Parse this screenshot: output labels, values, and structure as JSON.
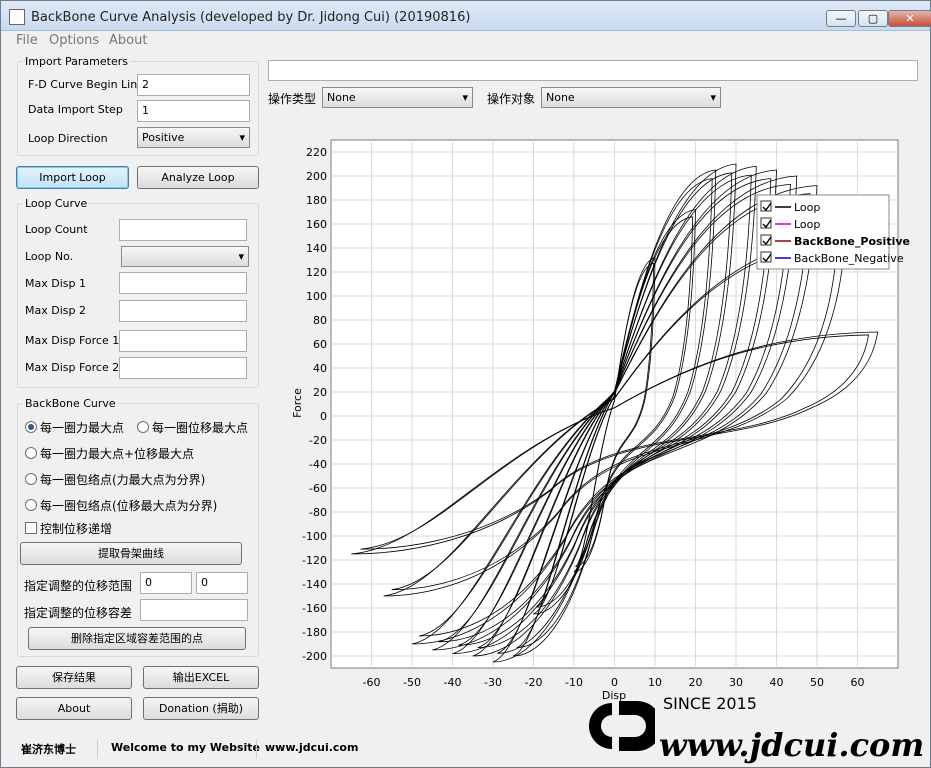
{
  "window": {
    "title": "BackBone Curve Analysis (developed by Dr. Jidong Cui) (20190816)"
  },
  "menubar": {
    "items": [
      "File",
      "Options",
      "About"
    ]
  },
  "import_parameters": {
    "title": "Import Parameters",
    "begin_line_label": "F-D Curve Begin Line",
    "begin_line_value": "2",
    "step_label": "Data Import Step",
    "step_value": "1",
    "direction_label": "Loop Direction",
    "direction_value": "Positive"
  },
  "buttons": {
    "import_loop": "Import Loop",
    "analyze_loop": "Analyze Loop",
    "extract": "提取骨架曲线",
    "delete_points": "删除指定区域容差范围的点",
    "save": "保存结果",
    "export_excel": "输出EXCEL",
    "about": "About",
    "donation": "Donation (捐助)"
  },
  "loop_curve": {
    "title": "Loop Curve",
    "count_label": "Loop Count",
    "no_label": "Loop No.",
    "max_disp1_label": "Max Disp 1",
    "max_disp2_label": "Max Disp 2",
    "max_force1_label": "Max Disp Force 1",
    "max_force2_label": "Max Disp Force 2",
    "values": [
      "",
      "",
      "",
      "",
      ""
    ]
  },
  "backbone": {
    "title": "BackBone Curve",
    "opt_force_max": "每一圈力最大点",
    "opt_disp_max": "每一圈位移最大点",
    "opt_force_disp_max": "每一圈力最大点+位移最大点",
    "opt_envelope_force": "每一圈包络点(力最大点为分界)",
    "opt_envelope_disp": "每一圈包络点(位移最大点为分界)",
    "monotonic_label": "控制位移递增",
    "range_label": "指定调整的位移范围",
    "range_from": "0",
    "range_to": "0",
    "tolerance_label": "指定调整的位移容差",
    "tolerance_value": ""
  },
  "operation": {
    "type_label": "操作类型",
    "type_value": "None",
    "object_label": "操作对象",
    "object_value": "None",
    "top_field": ""
  },
  "chart_data": {
    "type": "line",
    "xlabel": "Disp",
    "ylabel": "Force",
    "xlim": [
      -70,
      70
    ],
    "ylim": [
      -210,
      230
    ],
    "x_ticks": [
      -60,
      -50,
      -40,
      -30,
      -20,
      -10,
      0,
      10,
      20,
      30,
      40,
      50,
      60
    ],
    "y_ticks": [
      -200,
      -180,
      -160,
      -140,
      -120,
      -100,
      -80,
      -60,
      -40,
      -20,
      0,
      20,
      40,
      60,
      80,
      100,
      120,
      140,
      160,
      180,
      200,
      220
    ],
    "grid": true,
    "legend_position": "top-right",
    "legend": [
      "Loop",
      "Loop",
      "BackBone_Positive",
      "BackBone_Negative"
    ],
    "loop_amplitudes": [
      {
        "disp": 10,
        "force_pos": 132,
        "force_neg": -130
      },
      {
        "disp": 20,
        "force_pos": 172,
        "force_neg": -165
      },
      {
        "disp": 25,
        "force_pos": 205,
        "force_neg": -200
      },
      {
        "disp": 30,
        "force_pos": 210,
        "force_neg": -205
      },
      {
        "disp": 35,
        "force_pos": 208,
        "force_neg": -200
      },
      {
        "disp": 40,
        "force_pos": 205,
        "force_neg": -198
      },
      {
        "disp": 45,
        "force_pos": 200,
        "force_neg": -195
      },
      {
        "disp": 50,
        "force_pos": 192,
        "force_neg": -190
      },
      {
        "disp": 57,
        "force_pos": 150,
        "force_neg": -150
      },
      {
        "disp": 65,
        "force_pos": 70,
        "force_neg": -115
      }
    ]
  },
  "statusbar": {
    "author": "崔济东博士",
    "welcome": "Welcome to my Website",
    "url": "www.jdcui.com"
  },
  "watermark": {
    "since": "SINCE 2015",
    "site": "www.jdcui.com"
  }
}
